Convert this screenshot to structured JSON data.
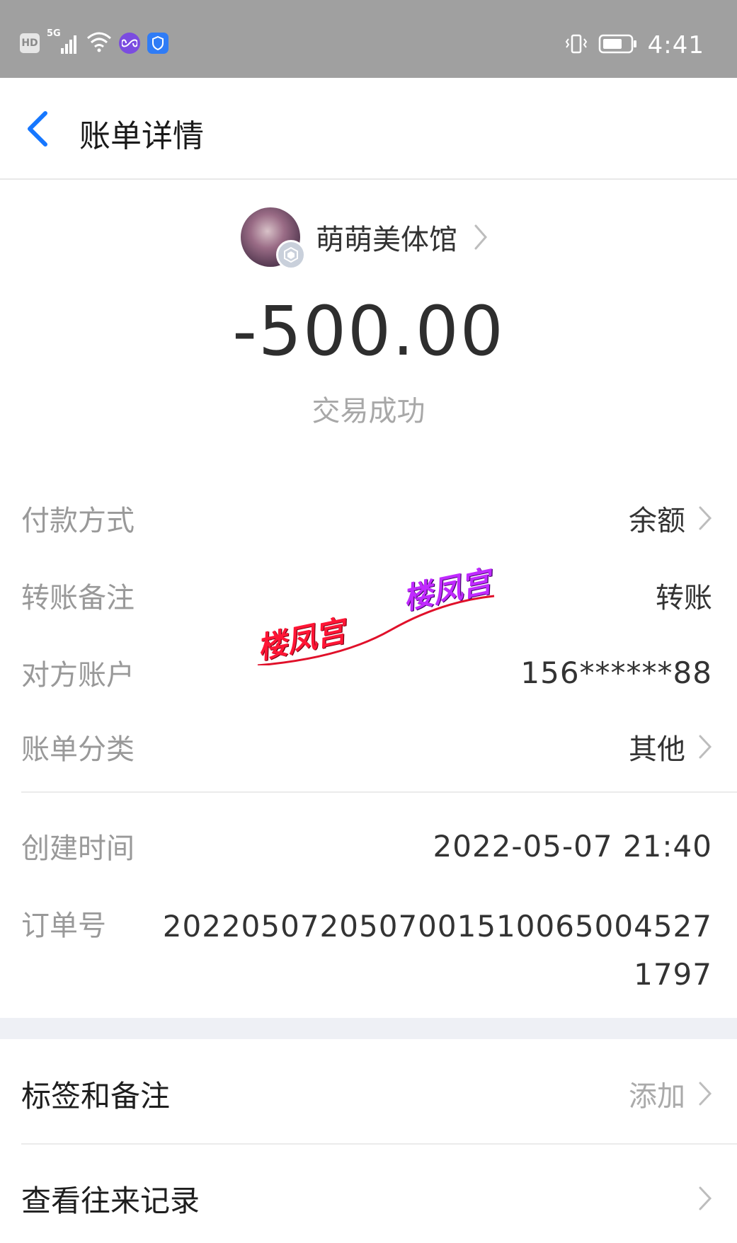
{
  "status_bar": {
    "hd": "HD",
    "network": "5G",
    "time": "4:41"
  },
  "nav": {
    "title": "账单详情"
  },
  "merchant": {
    "name": "萌萌美体馆"
  },
  "transaction": {
    "amount": "-500.00",
    "status": "交易成功"
  },
  "details": [
    {
      "label": "付款方式",
      "value": "余额",
      "has_chevron": true
    },
    {
      "label": "转账备注",
      "value": "转账",
      "has_chevron": false
    },
    {
      "label": "对方账户",
      "value": "156******88",
      "has_chevron": false
    },
    {
      "label": "账单分类",
      "value": "其他",
      "has_chevron": true
    }
  ],
  "meta": {
    "created_label": "创建时间",
    "created_value": "2022-05-07 21:40",
    "order_label": "订单号",
    "order_value": "2022050720507001510065004527 1797"
  },
  "tags": {
    "label": "标签和备注",
    "action": "添加"
  },
  "history": {
    "label": "查看往来记录"
  },
  "watermarks": [
    "楼凤宫",
    "楼凤宫"
  ],
  "colors": {
    "accent_blue": "#1677ff",
    "status_bar": "#a0a0a0",
    "watermark_red": "#ff1535",
    "watermark_purple": "#c02aff"
  }
}
